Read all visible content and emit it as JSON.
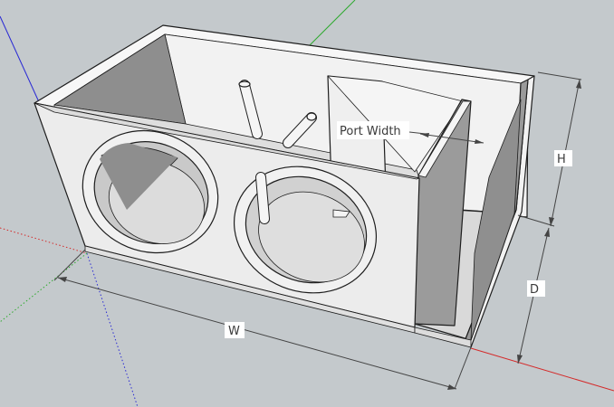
{
  "dimensions": {
    "width_label": "W",
    "height_label": "H",
    "depth_label": "D",
    "port_width_label": "Port Width"
  },
  "colors": {
    "background": "#c4c9cc",
    "panel_light": "#f4f4f4",
    "panel_front": "#ececec",
    "panel_shade": "#8e8e8e",
    "panel_dark": "#9b9b9b",
    "edge": "#1e1e1e",
    "axis_red": "#d42a2a",
    "axis_green": "#2faa2f",
    "axis_blue": "#2a2ad4"
  }
}
